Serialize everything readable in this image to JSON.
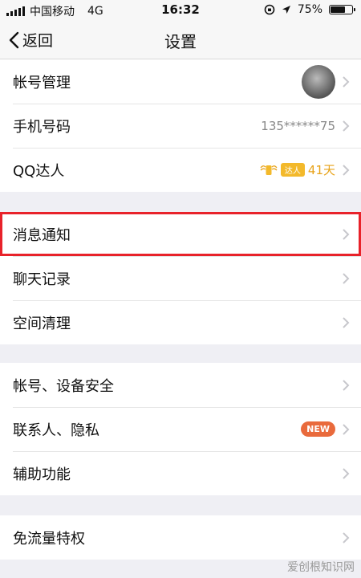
{
  "status_bar": {
    "carrier": "中国移动",
    "network": "4G",
    "time": "16:32",
    "battery": "75%",
    "battery_level": 0.75
  },
  "nav": {
    "back_label": "返回",
    "title": "设置"
  },
  "account": {
    "account_management": "帐号管理",
    "phone_label": "手机号码",
    "phone_value": "135******75",
    "qq_daren_label": "QQ达人",
    "qq_daren_badge": "达人",
    "qq_daren_days": "41天"
  },
  "general": {
    "message_notification": "消息通知",
    "chat_history": "聊天记录",
    "storage_cleanup": "空间清理"
  },
  "privacy": {
    "account_device_security": "帐号、设备安全",
    "contacts_privacy": "联系人、隐私",
    "new_badge": "NEW",
    "accessibility": "辅助功能"
  },
  "free_data": {
    "label": "免流量特权"
  },
  "watermark": "爱创根知识网",
  "colors": {
    "highlight": "#e8222a",
    "new_badge": "#e96a3c",
    "daren": "#e8a31a"
  }
}
